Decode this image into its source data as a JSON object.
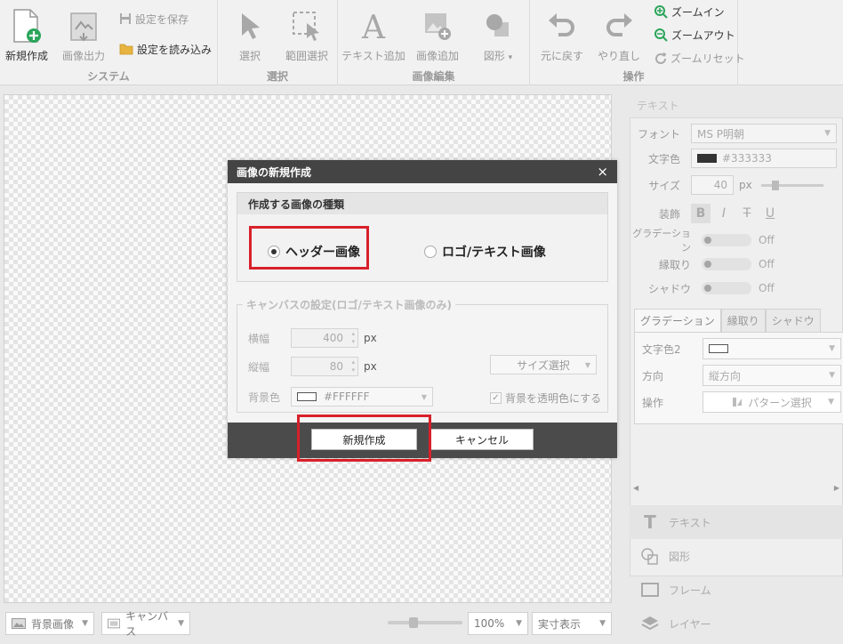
{
  "ribbon": {
    "system": {
      "label": "システム",
      "new_label": "新規作成",
      "export_label": "画像出力",
      "save_label": "設定を保存",
      "load_label": "設定を読み込み"
    },
    "select": {
      "label": "選択",
      "select_label": "選択",
      "range_label": "範囲選択"
    },
    "image_edit": {
      "label": "画像編集",
      "add_text_label": "テキスト追加",
      "add_image_label": "画像追加",
      "shape_label": "図形"
    },
    "operation": {
      "label": "操作",
      "undo_label": "元に戻す",
      "redo_label": "やり直し",
      "zoom_in_label": "ズームイン",
      "zoom_out_label": "ズームアウト",
      "zoom_reset_label": "ズームリセット"
    }
  },
  "bottom_bar": {
    "background_image": "背景画像",
    "canvas": "キャンバス",
    "zoom": "100%",
    "display_mode": "実寸表示"
  },
  "right_panel": {
    "title": "テキスト",
    "font_label": "フォント",
    "font_value": "MS P明朝",
    "color_label": "文字色",
    "color_value": "#333333",
    "size_label": "サイズ",
    "size_value": "40",
    "size_unit": "px",
    "decoration_label": "装飾",
    "deco_bold": "B",
    "deco_italic": "I",
    "deco_strike": "T",
    "deco_underline": "U",
    "gradient_label": "グラデーション",
    "gradient_state": "Off",
    "outline_label": "縁取り",
    "outline_state": "Off",
    "shadow_label": "シャドウ",
    "shadow_state": "Off",
    "subtabs": [
      "グラデーション",
      "縁取り",
      "シャドウ"
    ],
    "color2_label": "文字色2",
    "direction_label": "方向",
    "direction_value": "縦方向",
    "operation_label": "操作",
    "pattern_button": "パターン選択",
    "side_buttons": {
      "text": "テキスト",
      "shape": "図形",
      "frame": "フレーム",
      "layer": "レイヤー"
    }
  },
  "dialog": {
    "title": "画像の新規作成",
    "close": "×",
    "type_section": "作成する画像の種類",
    "option_header": "ヘッダー画像",
    "option_logo": "ロゴ/テキスト画像",
    "canvas_section": "キャンバスの設定(ロゴ/テキスト画像のみ)",
    "width_label": "横幅",
    "width_value": "400",
    "height_label": "縦幅",
    "height_value": "80",
    "unit": "px",
    "size_select": "サイズ選択",
    "bg_color_label": "背景色",
    "bg_color_value": "#FFFFFF",
    "transparent_label": "背景を透明色にする",
    "create_button": "新規作成",
    "cancel_button": "キャンセル"
  }
}
